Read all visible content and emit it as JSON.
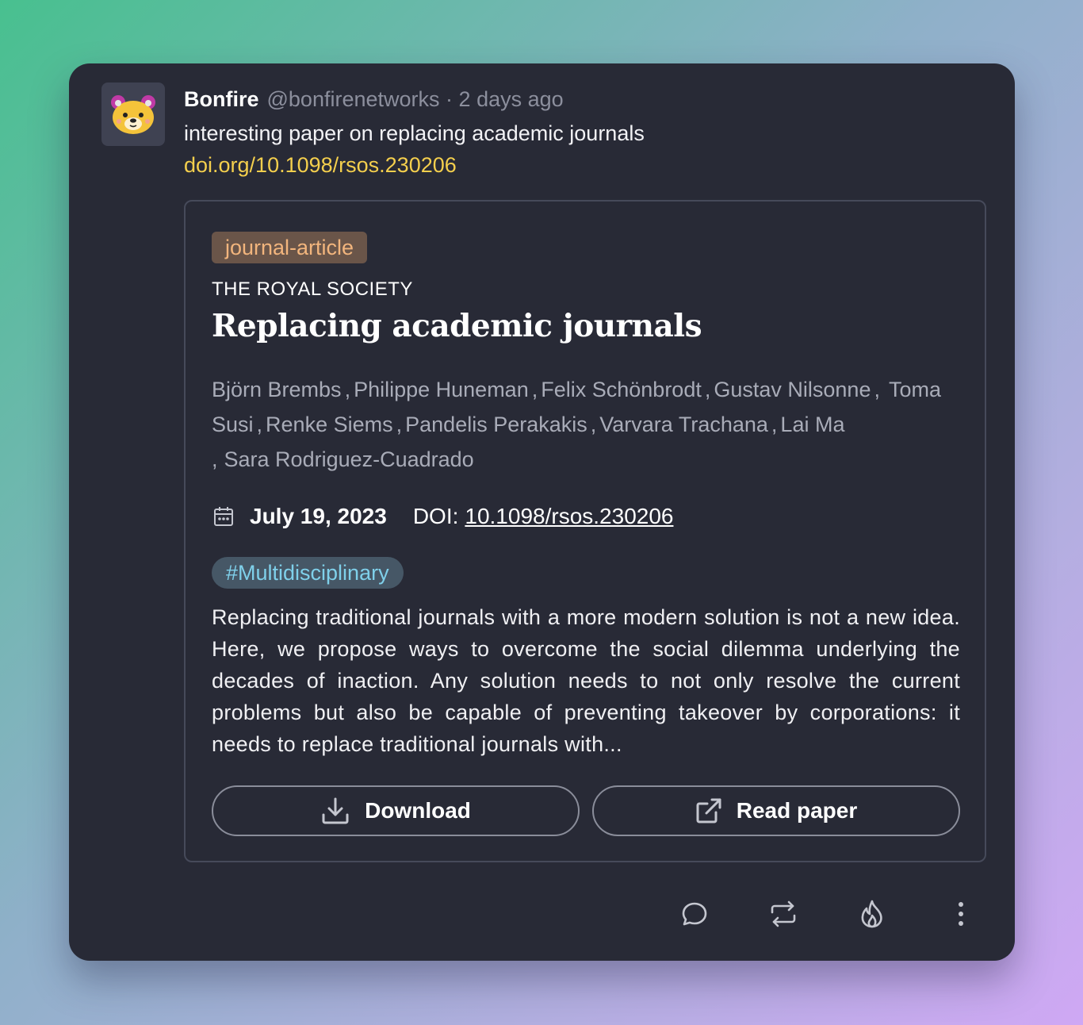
{
  "post": {
    "author_name": "Bonfire",
    "author_handle": "@bonfirenetworks",
    "separator": "·",
    "time_ago": "2 days ago",
    "text": "interesting paper on replacing academic journals",
    "link": "doi.org/10.1098/rsos.230206"
  },
  "paper": {
    "type_badge": "journal-article",
    "publisher": "THE ROYAL SOCIETY",
    "title": "Replacing academic journals",
    "authors": [
      "Björn Brembs",
      "Philippe Huneman",
      "Felix Schönbrodt",
      "Gustav Nilsonne",
      "Toma Susi",
      "Renke Siems",
      "Pandelis Perakakis",
      "Varvara Trachana",
      "Lai Ma",
      "Sara Rodriguez-Cuadrado"
    ],
    "date": "July 19, 2023",
    "doi_label": "DOI:",
    "doi": "10.1098/rsos.230206",
    "hashtag": "#Multidisciplinary",
    "abstract": "Replacing traditional journals with a more modern solution is not a new idea. Here, we propose ways to overcome the social dilemma underlying the decades of inaction. Any solution needs to not only resolve the current problems but also be capable of preventing takeover by corporations: it needs to replace traditional journals with...",
    "download_label": "Download",
    "read_label": "Read paper"
  },
  "colors": {
    "card_bg": "#282a36",
    "link": "#f4cf4d",
    "badge_bg": "#6a5549",
    "badge_text": "#f2b57d",
    "hashtag_bg": "#465766",
    "hashtag_text": "#7fd0ea"
  },
  "icons": {
    "avatar": "bear-avatar-icon",
    "calendar": "calendar-icon",
    "download": "download-icon",
    "read": "external-link-icon",
    "reply": "reply-icon",
    "boost": "boost-icon",
    "like": "flame-icon",
    "more": "more-icon"
  }
}
